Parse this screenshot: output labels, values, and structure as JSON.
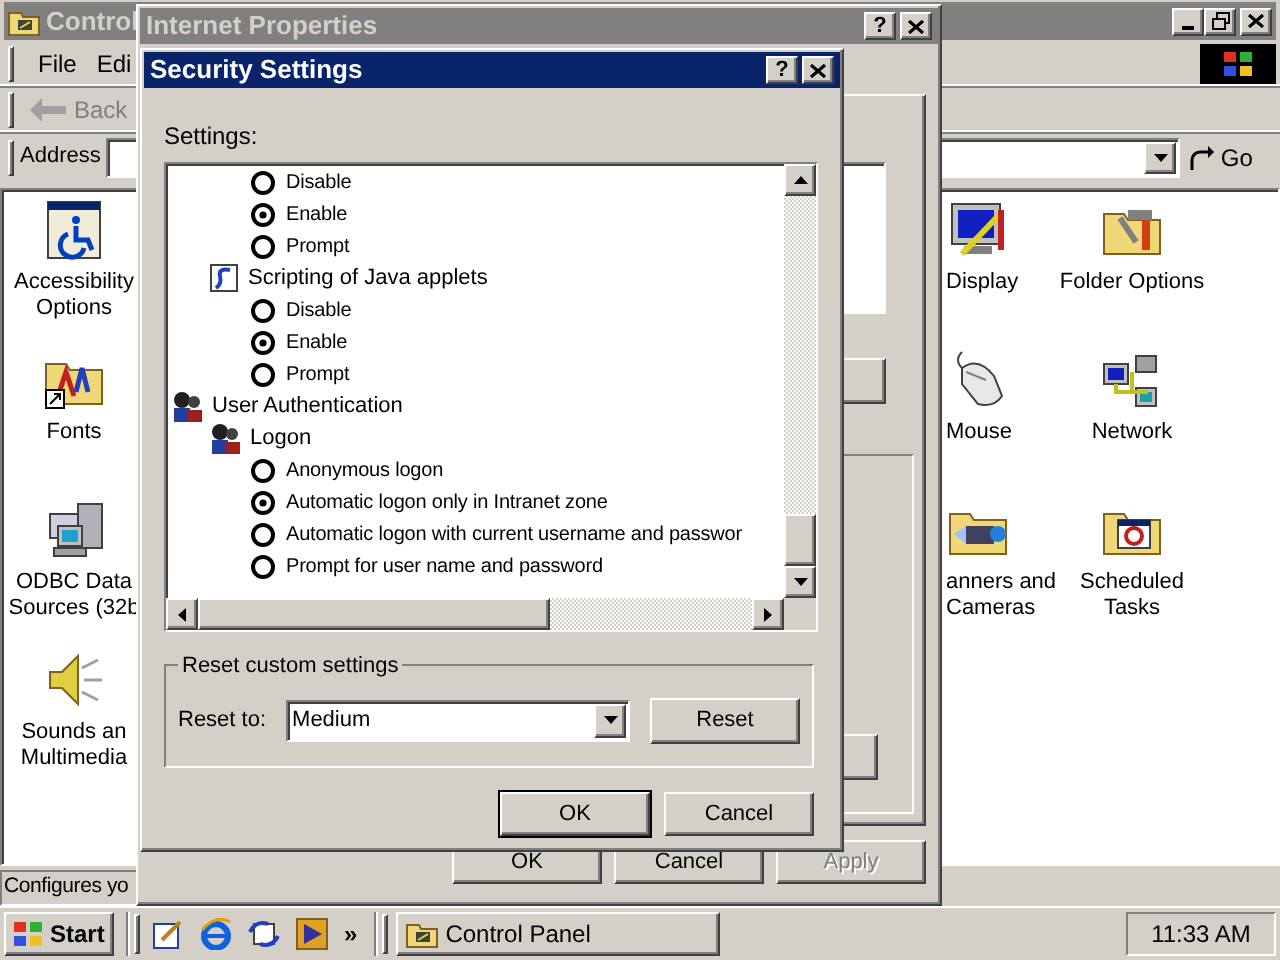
{
  "control_panel": {
    "title": "Control",
    "menu": [
      "File",
      "Edi"
    ],
    "back": "Back",
    "address_label": "Address",
    "go": "Go",
    "icons": [
      {
        "kind": "accessibility",
        "label": "Accessibility Options"
      },
      {
        "kind": "display",
        "label": "Display"
      },
      {
        "kind": "folder-options",
        "label": "Folder Options"
      },
      {
        "kind": "fonts",
        "label": "Fonts"
      },
      {
        "kind": "mouse",
        "label": "Mouse"
      },
      {
        "kind": "network",
        "label": "Network"
      },
      {
        "kind": "odbc",
        "label": "ODBC Data Sources (32b"
      },
      {
        "kind": "scanner",
        "label": "anners and Cameras"
      },
      {
        "kind": "scheduled",
        "label": "Scheduled Tasks"
      },
      {
        "kind": "sounds",
        "label": "Sounds an Multimedia"
      }
    ],
    "status": "Configures yo"
  },
  "internet_properties": {
    "title": "Internet Properties",
    "help": "?",
    "buttons": [
      {
        "label": "OK",
        "disabled": false
      },
      {
        "label": "Cancel",
        "disabled": false
      },
      {
        "label": "Apply",
        "disabled": true
      }
    ]
  },
  "security_settings": {
    "title": "Security Settings",
    "help": "?",
    "settings_label": "Settings:",
    "tree": [
      {
        "children": [
          {
            "children": [
              {
                "kind": "radio",
                "label": "Disable",
                "selected": false
              },
              {
                "kind": "radio",
                "label": "Enable",
                "selected": true
              },
              {
                "kind": "radio",
                "label": "Prompt",
                "selected": false
              }
            ]
          },
          {
            "kind": "script",
            "label": "Scripting of Java applets",
            "children": [
              {
                "kind": "radio",
                "label": "Disable",
                "selected": false
              },
              {
                "kind": "radio",
                "label": "Enable",
                "selected": true
              },
              {
                "kind": "radio",
                "label": "Prompt",
                "selected": false
              }
            ]
          }
        ]
      },
      {
        "kind": "user",
        "label": "User Authentication",
        "children": [
          {
            "kind": "user",
            "label": "Logon",
            "children": [
              {
                "kind": "radio",
                "label": "Anonymous logon",
                "selected": false
              },
              {
                "kind": "radio",
                "label": "Automatic logon only in Intranet zone",
                "selected": true
              },
              {
                "kind": "radio",
                "label": "Automatic logon with current username and passwor",
                "selected": false
              },
              {
                "kind": "radio",
                "label": "Prompt for user name and password",
                "selected": false
              }
            ]
          }
        ]
      }
    ],
    "reset_group": {
      "title": "Reset custom settings",
      "label": "Reset to:",
      "value": "Medium",
      "button": "Reset"
    },
    "buttons": [
      {
        "label": "OK",
        "default": true
      },
      {
        "label": "Cancel",
        "default": false
      }
    ]
  },
  "taskbar": {
    "start": "Start",
    "more": "»",
    "tasks": [
      {
        "label": "Control Panel",
        "selected": false
      }
    ],
    "clock": "11:33 AM"
  }
}
